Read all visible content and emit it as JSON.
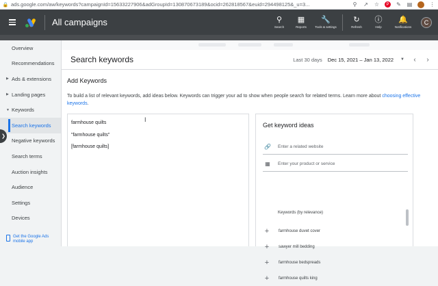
{
  "browser": {
    "url": "ads.google.com/aw/keywords?campaignId=15633227906&adGroupId=130870673189&ocid=262818567&euid=294498125&_u=3..."
  },
  "header": {
    "title": "All campaigns",
    "tools": [
      {
        "label": "Search",
        "icon": "search-icon"
      },
      {
        "label": "Reports",
        "icon": "reports-icon"
      },
      {
        "label": "Tools & settings",
        "icon": "tools-icon"
      },
      {
        "label": "Refresh",
        "icon": "refresh-icon"
      },
      {
        "label": "Help",
        "icon": "help-icon"
      },
      {
        "label": "Notifications",
        "icon": "bell-icon"
      }
    ],
    "avatar_letter": "C"
  },
  "sidebar": {
    "items": [
      {
        "label": "Overview"
      },
      {
        "label": "Recommendations"
      },
      {
        "label": "Ads & extensions"
      },
      {
        "label": "Landing pages"
      },
      {
        "label": "Keywords"
      },
      {
        "label": "Search keywords"
      },
      {
        "label": "Negative keywords"
      },
      {
        "label": "Search terms"
      },
      {
        "label": "Auction insights"
      },
      {
        "label": "Audience"
      },
      {
        "label": "Settings"
      },
      {
        "label": "Devices"
      }
    ],
    "mobile_promo": "Get the Google Ads mobile app"
  },
  "main": {
    "page_title": "Search keywords",
    "date_range_label": "Last 30 days",
    "date_range": "Dec 15, 2021 – Jan 13, 2022",
    "add_keywords_title": "Add Keywords",
    "description": "To build a list of relevant keywords, add ideas below. Keywords can trigger your ad to show when people search for related terms. Learn more about ",
    "description_link": "choosing effective keywords",
    "description_end": ".",
    "keywords_text": [
      "farmhouse quilts",
      "\"farmhouse quilts\"",
      "[farmhouse quilts]"
    ],
    "ideas": {
      "title": "Get keyword ideas",
      "website_placeholder": "Enter a related website",
      "product_placeholder": "Enter your product or service",
      "list_header": "Keywords (by relevance)",
      "suggestions": [
        "farmhouse duvet cover",
        "sawyer mill bedding",
        "farmhouse bedspreads",
        "farmhouse quilts king"
      ]
    }
  },
  "colors": {
    "header_bg": "#3c4043",
    "accent": "#1a73e8"
  }
}
